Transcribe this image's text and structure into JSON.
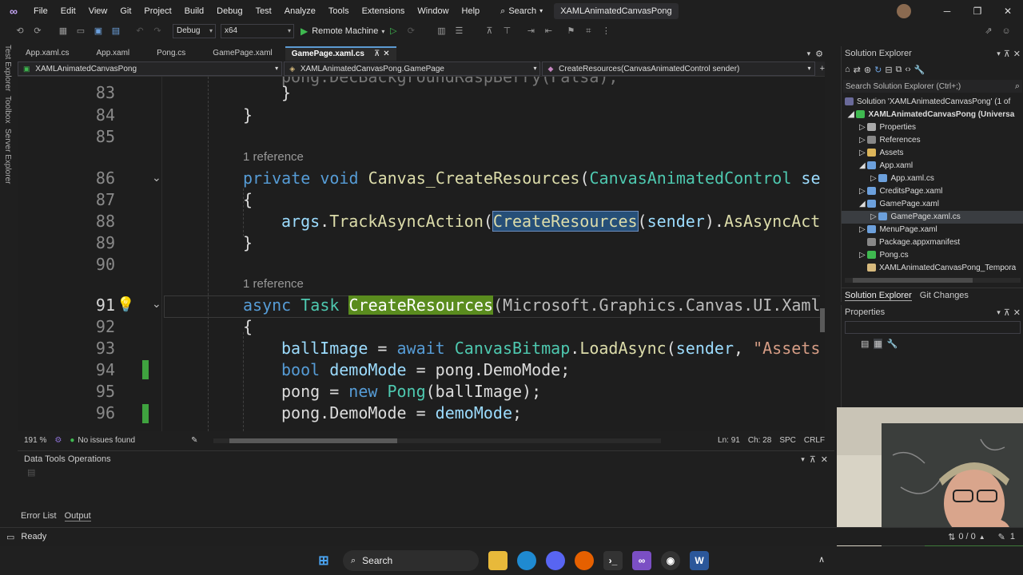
{
  "titlebar": {
    "menus": [
      "File",
      "Edit",
      "View",
      "Git",
      "Project",
      "Build",
      "Debug",
      "Test",
      "Analyze",
      "Tools",
      "Extensions",
      "Window",
      "Help"
    ],
    "search_label": "Search",
    "solution_name": "XAMLAnimatedCanvasPong"
  },
  "toolbar": {
    "config": "Debug",
    "platform": "x64",
    "run_target": "Remote Machine"
  },
  "left_strip": [
    "Test Explorer",
    "Toolbox",
    "Server Explorer"
  ],
  "doc_tabs": [
    {
      "label": "App.xaml.cs"
    },
    {
      "label": "App.xaml"
    },
    {
      "label": "Pong.cs"
    },
    {
      "label": "GamePage.xaml"
    },
    {
      "label": "GamePage.xaml.cs"
    }
  ],
  "navbar": {
    "project": "XAMLAnimatedCanvasPong",
    "class": "XAMLAnimatedCanvasPong.GamePage",
    "member": "CreateResources(CanvasAnimatedControl sender)"
  },
  "editor": {
    "lines": [
      {
        "num": "83",
        "text": "}"
      },
      {
        "num": "84",
        "text": "}"
      },
      {
        "num": "85",
        "text": ""
      },
      {
        "num": "86",
        "text": "private void Canvas_CreateResources(CanvasAnimatedControl se"
      },
      {
        "num": "87",
        "text": "{"
      },
      {
        "num": "88",
        "text": "args.TrackAsyncAction(CreateResources(sender).AsAsyncAct"
      },
      {
        "num": "89",
        "text": "}"
      },
      {
        "num": "90",
        "text": ""
      },
      {
        "num": "91",
        "text": "async Task CreateResources(Microsoft.Graphics.Canvas.UI.Xaml"
      },
      {
        "num": "92",
        "text": "{"
      },
      {
        "num": "93",
        "text": "ballImage = await CanvasBitmap.LoadAsync(sender, \"Assets"
      },
      {
        "num": "94",
        "text": "bool demoMode = pong.DemoMode;"
      },
      {
        "num": "95",
        "text": "pong = new Pong(ballImage);"
      },
      {
        "num": "96",
        "text": "pong.DemoMode = demoMode;"
      }
    ],
    "reference_label": "1 reference",
    "code": {
      "l86_kw1": "private",
      "l86_kw2": "void",
      "l86_fn": "Canvas_CreateResources",
      "l86_p1": "(",
      "l86_ty": "CanvasAnimatedControl",
      "l86_rest": " se",
      "l88_id": "args",
      "l88_dot": ".",
      "l88_fn": "TrackAsyncAction",
      "l88_p": "(",
      "l88_hl": "CreateResources",
      "l88_p2": "(",
      "l88_id2": "sender",
      "l88_p3": ").",
      "l88_fn2": "AsAsyncAct",
      "l91_kw": "async",
      "l91_ty": "Task",
      "l91_hl": "CreateResources",
      "l91_rest": "(Microsoft.Graphics.Canvas.UI.Xaml",
      "l93_id": "ballImage",
      "l93_eq": " = ",
      "l93_kw": "await",
      "l93_ty": "CanvasBitmap",
      "l93_dot": ".",
      "l93_fn": "LoadAsync",
      "l93_p": "(",
      "l93_id2": "sender",
      "l93_c": ", ",
      "l93_st": "\"Assets",
      "l94_kw": "bool",
      "l94_id": "demoMode",
      "l94_rest": " = pong.DemoMode;",
      "l95_a": "pong = ",
      "l95_kw": "new",
      "l95_ty": "Pong",
      "l95_rest": "(ballImage);",
      "l96_a": "pong.DemoMode = ",
      "l96_id": "demoMode",
      "l96_end": ";"
    }
  },
  "editor_status": {
    "zoom": "191 %",
    "issues": "No issues found",
    "line": "Ln: 91",
    "col": "Ch: 28",
    "spc": "SPC",
    "crlf": "CRLF"
  },
  "data_tools": {
    "title": "Data Tools Operations"
  },
  "bottom_tabs": [
    "Error List",
    "Output"
  ],
  "solution_explorer": {
    "title": "Solution Explorer",
    "search_placeholder": "Search Solution Explorer (Ctrl+;)",
    "items": [
      {
        "label": "Solution 'XAMLAnimatedCanvasPong' (1 of"
      },
      {
        "label": "XAMLAnimatedCanvasPong (Universa"
      },
      {
        "label": "Properties"
      },
      {
        "label": "References"
      },
      {
        "label": "Assets"
      },
      {
        "label": "App.xaml"
      },
      {
        "label": "App.xaml.cs"
      },
      {
        "label": "CreditsPage.xaml"
      },
      {
        "label": "GamePage.xaml"
      },
      {
        "label": "GamePage.xaml.cs"
      },
      {
        "label": "MenuPage.xaml"
      },
      {
        "label": "Package.appxmanifest"
      },
      {
        "label": "Pong.cs"
      },
      {
        "label": "XAMLAnimatedCanvasPong_Tempora"
      }
    ],
    "tabs": [
      "Solution Explorer",
      "Git Changes"
    ]
  },
  "properties": {
    "title": "Properties"
  },
  "statusbar": {
    "ready": "Ready",
    "errors": "0 / 0",
    "sync": "1"
  },
  "taskbar": {
    "search": "Search"
  },
  "colors": {
    "accent": "#5c9ad2",
    "keyword": "#569cd6",
    "type": "#4ec9b0",
    "method": "#dcdcaa",
    "highlight_green": "#5a8c1e"
  }
}
